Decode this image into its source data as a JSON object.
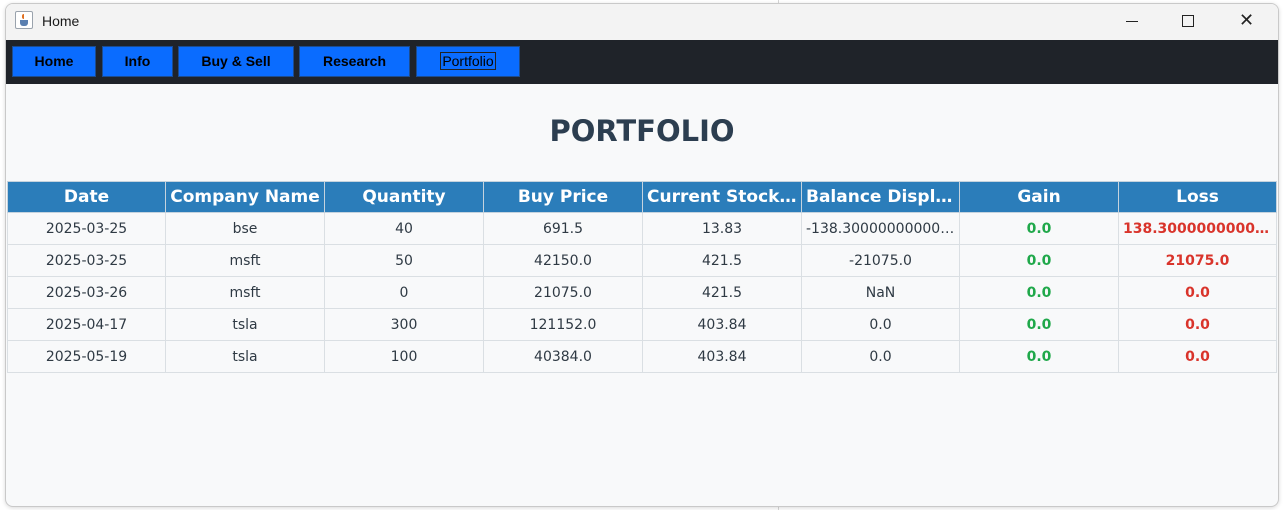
{
  "window": {
    "title": "Home",
    "icon": "java-coffee-icon"
  },
  "nav": {
    "items": [
      {
        "label": "Home"
      },
      {
        "label": "Info"
      },
      {
        "label": "Buy & Sell"
      },
      {
        "label": "Research"
      },
      {
        "label": "Portfolio",
        "active": true
      }
    ]
  },
  "page": {
    "heading": "PORTFOLIO"
  },
  "colors": {
    "nav_bg": "#1f2329",
    "button": "#0a6cff",
    "header": "#2b7dba",
    "gain": "#1fa84a",
    "loss": "#d9342b",
    "heading": "#2c3e50"
  },
  "table": {
    "columns": [
      "Date",
      "Company Name",
      "Quantity",
      "Buy Price",
      "Current Stock ...",
      "Balance Display",
      "Gain",
      "Loss"
    ],
    "rows": [
      [
        "2025-03-25",
        "bse",
        "40",
        "691.5",
        "13.83",
        "-138.300000000000...",
        "0.0",
        "138.300000000000..."
      ],
      [
        "2025-03-25",
        "msft",
        "50",
        "42150.0",
        "421.5",
        "-21075.0",
        "0.0",
        "21075.0"
      ],
      [
        "2025-03-26",
        "msft",
        "0",
        "21075.0",
        "421.5",
        "NaN",
        "0.0",
        "0.0"
      ],
      [
        "2025-04-17",
        "tsla",
        "300",
        "121152.0",
        "403.84",
        "0.0",
        "0.0",
        "0.0"
      ],
      [
        "2025-05-19",
        "tsla",
        "100",
        "40384.0",
        "403.84",
        "0.0",
        "0.0",
        "0.0"
      ]
    ]
  }
}
